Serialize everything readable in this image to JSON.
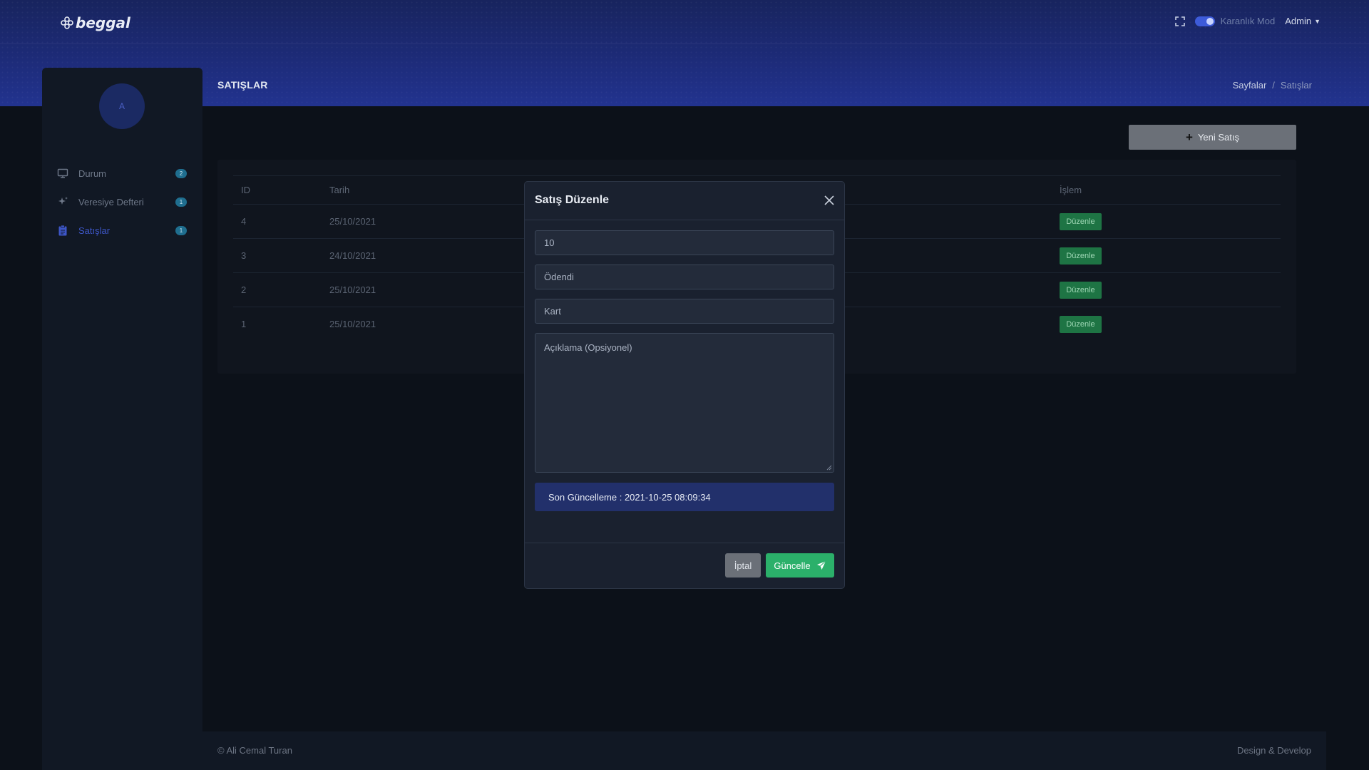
{
  "app": {
    "logo_text": "beggal",
    "dark_mode_label": "Karanlık Mod",
    "user_label": "Admin"
  },
  "page": {
    "title": "SATIŞLAR",
    "breadcrumb": [
      "Sayfalar",
      "/",
      "Satışlar"
    ]
  },
  "sidebar": {
    "avatar_letter": "A",
    "items": [
      {
        "label": "Durum",
        "badge": "2",
        "icon": "monitor-icon"
      },
      {
        "label": "Veresiye Defteri",
        "badge": "1",
        "icon": "sparkle-icon"
      },
      {
        "label": "Satışlar",
        "badge": "1",
        "icon": "clipboard-icon"
      }
    ]
  },
  "toolbar": {
    "new_sale_label": "Yeni Satış"
  },
  "table": {
    "headers": {
      "id": "ID",
      "date": "Tarih",
      "action": "İşlem"
    },
    "rows": [
      {
        "id": "4",
        "date": "25/10/2021",
        "action": "Düzenle"
      },
      {
        "id": "3",
        "date": "24/10/2021",
        "action": "Düzenle"
      },
      {
        "id": "2",
        "date": "25/10/2021",
        "action": "Düzenle"
      },
      {
        "id": "1",
        "date": "25/10/2021",
        "action": "Düzenle"
      }
    ]
  },
  "modal": {
    "title": "Satış Düzenle",
    "amount_value": "10",
    "status_value": "Ödendi",
    "payment_value": "Kart",
    "description_placeholder": "Açıklama (Opsiyonel)",
    "last_update": "Son Güncelleme : 2021-10-25 08:09:34",
    "cancel_label": "İptal",
    "update_label": "Güncelle"
  },
  "footer": {
    "left": "© Ali Cemal Turan",
    "right": "Design & Develop"
  },
  "colors": {
    "accent": "#3d56c7",
    "success": "#2bb06a",
    "badge": "#1f6e8f"
  }
}
